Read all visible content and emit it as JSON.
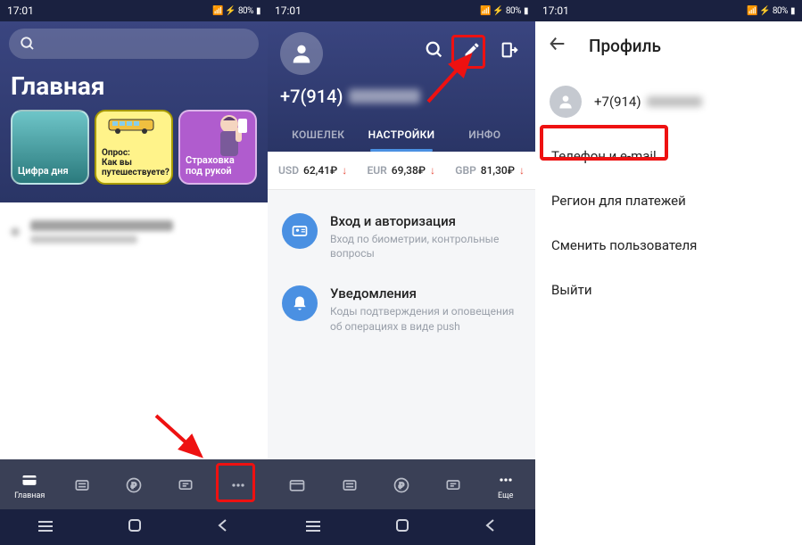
{
  "status": {
    "time": "17:01",
    "battery": "80%"
  },
  "screen1": {
    "title": "Главная",
    "cards": [
      {
        "label": "Цифра дня"
      },
      {
        "line1": "Опрос:",
        "line2": "Как вы",
        "line3": "путешествуете?"
      },
      {
        "line1": "Страховка",
        "line2": "под рукой"
      }
    ],
    "nav": {
      "home": "Главная"
    }
  },
  "screen2": {
    "phone_prefix": "+7(914)",
    "tabs": {
      "wallet": "КОШЕЛЕК",
      "settings": "НАСТРОЙКИ",
      "info": "ИНФО"
    },
    "rates": [
      {
        "cur": "USD",
        "val": "62,41₽"
      },
      {
        "cur": "EUR",
        "val": "69,38₽"
      },
      {
        "cur": "GBP",
        "val": "81,30₽"
      }
    ],
    "settings": [
      {
        "title": "Вход и авторизация",
        "desc": "Вход по биометрии, контрольные вопросы"
      },
      {
        "title": "Уведомления",
        "desc": "Коды подтверждения и оповещения об операциях в виде push"
      }
    ],
    "nav": {
      "more": "Еще"
    }
  },
  "screen3": {
    "title": "Профиль",
    "phone_prefix": "+7(914)",
    "items": {
      "phone_email": "Телефон и e-mail",
      "region": "Регион для платежей",
      "switch_user": "Сменить пользователя",
      "logout": "Выйти"
    }
  }
}
